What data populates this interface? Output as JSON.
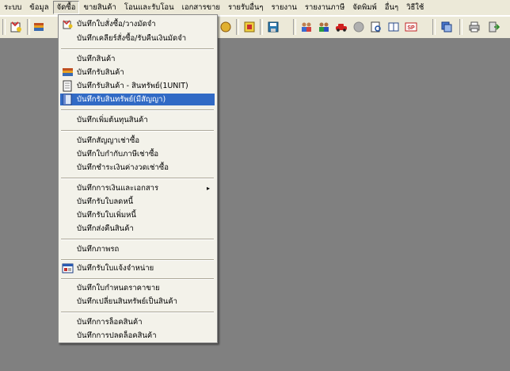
{
  "menubar": {
    "items": [
      "ระบบ",
      "ข้อมูล",
      "จัดซื้อ",
      "ขายสินค้า",
      "โอนและรับโอน",
      "เอกสารขาย",
      "รายรับอื่นๆ",
      "รายงาน",
      "รายงานภาษี",
      "จัดพิมพ์",
      "อื่นๆ",
      "วิธีใช้"
    ],
    "active_item": "จัดซื้อ"
  },
  "toolbar": {
    "icons": [
      "purchase-order-icon",
      "receipt-icon",
      "calendar-icon",
      "sheet-icon",
      "disk-icon",
      "people-icon",
      "user-pair-icon",
      "car-icon",
      "circle-icon",
      "search-doc-icon",
      "book-icon",
      "sp-icon",
      "windows-icon",
      "printer-icon",
      "exit-icon"
    ]
  },
  "menu": {
    "items": [
      {
        "label": "บันทึกใบสั่งซื้อ/วางมัดจำ",
        "icon": "po-icon"
      },
      {
        "label": "บันทึกเคลียร์สั่งซื้อ/รับคืนเงินมัดจำ"
      },
      {
        "label": "บันทึกสินค้า"
      },
      {
        "label": "บันทึกรับสินค้า",
        "icon": "books-icon"
      },
      {
        "label": "บันทึกรับสินค้า - สินทรัพย์(1UNIT)",
        "icon": "page-icon"
      },
      {
        "label": "บันทึกรับสินทรัพย์(มีสัญญา)",
        "icon": "doc-icon",
        "selected": true
      },
      {
        "label": "บันทึกเพิ่มต้นทุนสินค้า"
      },
      {
        "label": "บันทึกสัญญาเช่าซื้อ"
      },
      {
        "label": "บันทึกใบกำกับภาษีเช่าซื้อ"
      },
      {
        "label": "บันทึกชำระเงินค่างวดเช่าซื้อ"
      },
      {
        "label": "บันทึกการเงินและเอกสาร",
        "submenu": true
      },
      {
        "label": "บันทึกรับใบลดหนี้"
      },
      {
        "label": "บันทึกรับใบเพิ่มหนี้"
      },
      {
        "label": "บันทึกส่งคืนสินค้า"
      },
      {
        "label": "บันทึกภาพรถ"
      },
      {
        "label": "บันทึกรับใบแจ้งจำหน่าย",
        "icon": "form-icon"
      },
      {
        "label": "บันทึกใบกำหนดราคาขาย"
      },
      {
        "label": "บันทึกเปลี่ยนสินทรัพย์เป็นสินค้า"
      },
      {
        "label": "บันทึกการล็อคสินค้า"
      },
      {
        "label": "บันทึกการปลดล็อคสินค้า"
      }
    ],
    "submenu_arrow": "▸"
  }
}
